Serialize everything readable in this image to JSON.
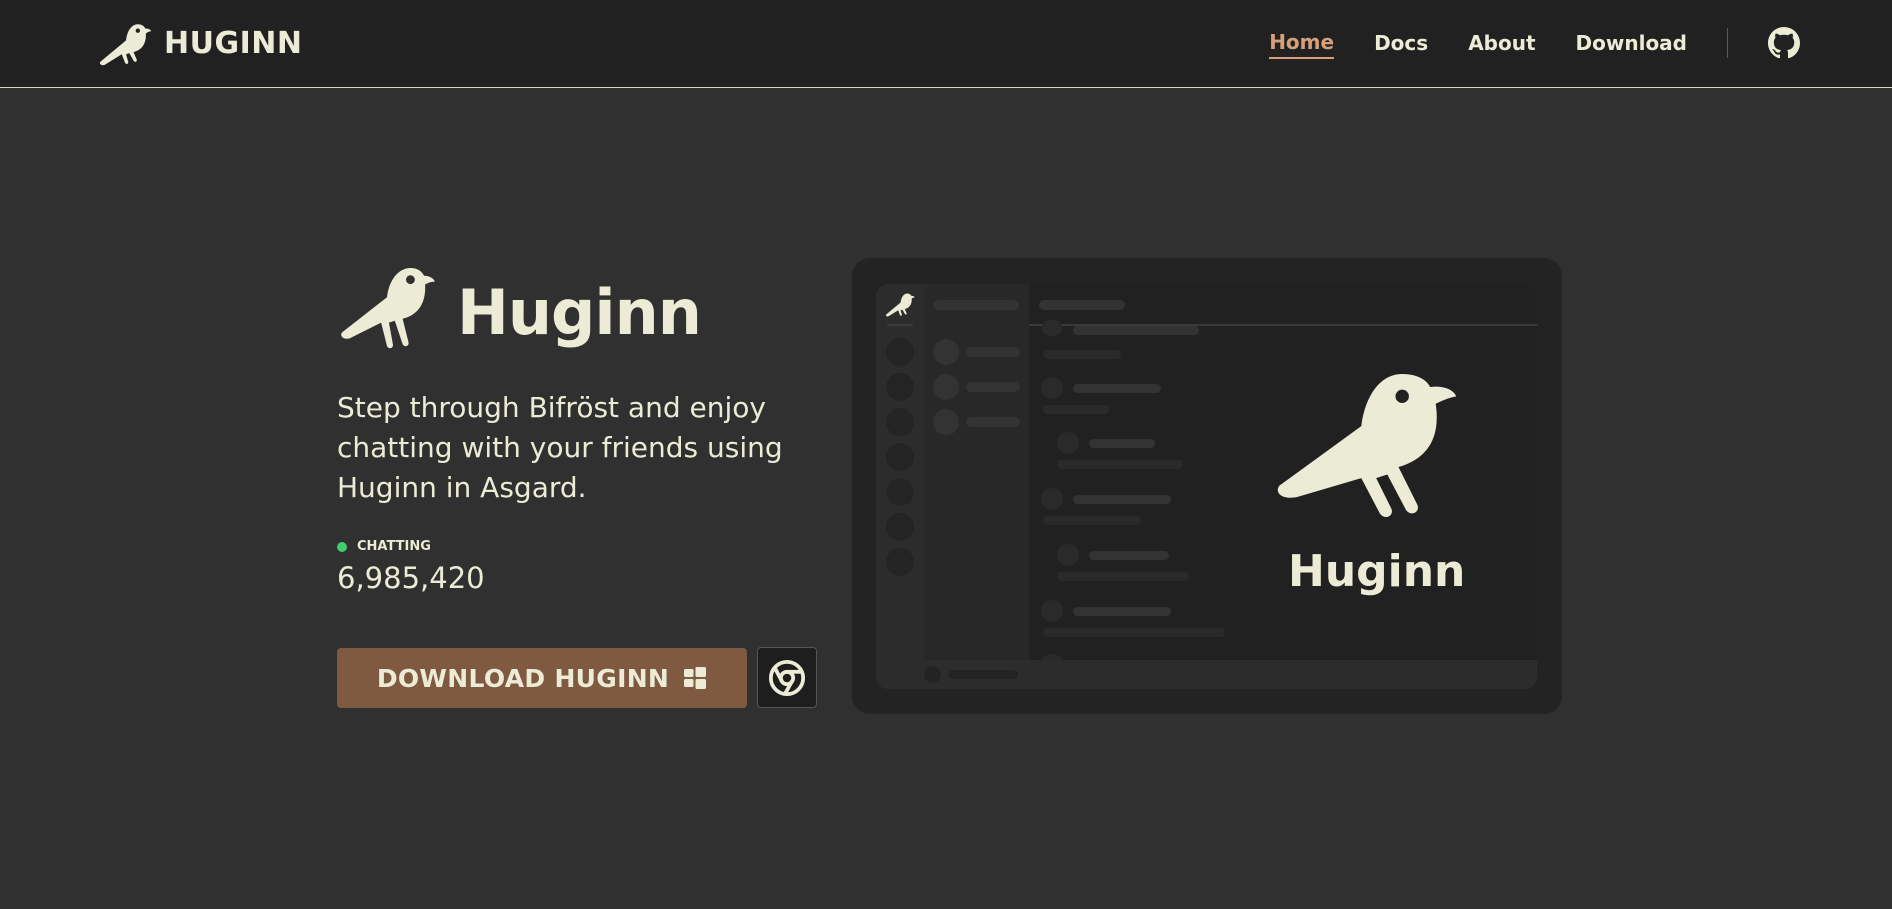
{
  "brand": {
    "name": "HUGINN",
    "logo_icon": "raven-icon"
  },
  "nav": {
    "links": [
      {
        "label": "Home",
        "active": true
      },
      {
        "label": "Docs",
        "active": false
      },
      {
        "label": "About",
        "active": false
      },
      {
        "label": "Download",
        "active": false
      }
    ],
    "github_icon": "github-icon"
  },
  "hero": {
    "title": "Huginn",
    "description": "Step through Bifröst and enjoy chatting with your friends using Huginn in Asgard.",
    "status_label": "CHATTING",
    "status_color": "#3ecf6e",
    "chat_count": "6,985,420",
    "download_label": "DOWNLOAD HUGINN",
    "download_icon": "windows-icon",
    "browser_icon": "chrome-icon"
  },
  "preview": {
    "title": "Huginn"
  },
  "colors": {
    "background": "#303030",
    "navbar": "#212121",
    "text": "#ecebd6",
    "accent": "#d7a07a",
    "button": "#7f5a41"
  }
}
